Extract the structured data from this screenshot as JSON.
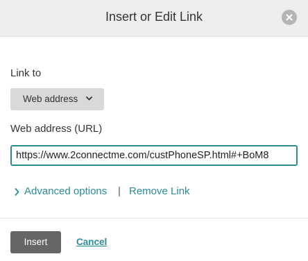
{
  "dialog": {
    "title": "Insert or Edit Link",
    "close_icon": "close-icon"
  },
  "form": {
    "link_to_label": "Link to",
    "link_type_selected": "Web address",
    "url_label": "Web address (URL)",
    "url_value": "https://www.2connectme.com/custPhoneSP.html#+BoM8"
  },
  "options": {
    "advanced_label": "Advanced options",
    "separator": "|",
    "remove_label": "Remove Link"
  },
  "footer": {
    "insert_label": "Insert",
    "cancel_label": "Cancel"
  },
  "colors": {
    "accent": "#2a8b99",
    "header_bg": "#eeeeee",
    "primary_button": "#666666",
    "select_bg": "#d9d9d9"
  }
}
